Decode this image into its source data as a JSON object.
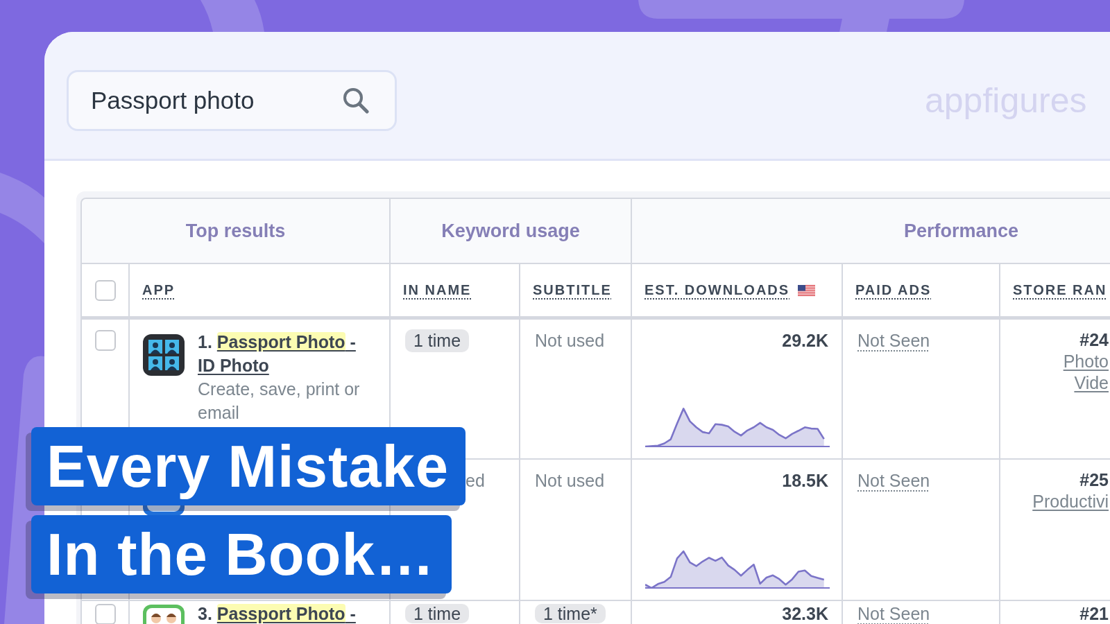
{
  "search": {
    "value": "Passport photo"
  },
  "logo": {
    "text": "appfigures"
  },
  "table": {
    "groups": [
      "Top results",
      "Keyword usage",
      "Performance"
    ],
    "select_all": {
      "checked": false
    },
    "columns": [
      {
        "label": "APP"
      },
      {
        "label": "IN NAME"
      },
      {
        "label": "SUBTITLE"
      },
      {
        "label": "EST. DOWNLOADS",
        "flag": true
      },
      {
        "label": "PAID ADS"
      },
      {
        "label": "STORE RAN"
      }
    ],
    "rows": [
      {
        "kind": "full",
        "checked": false,
        "icon": {
          "kind": "portrait-grid"
        },
        "number": "1.",
        "name": [
          {
            "text": "Passport Photo",
            "highlighted": true
          },
          {
            "text": " - ID Photo",
            "highlighted": false
          }
        ],
        "description": "Create, save, print or email",
        "in_name": {
          "kind": "pill",
          "text": "1 time"
        },
        "subtitle": {
          "kind": "plain",
          "text": "Not used"
        },
        "downloads": "29.2K",
        "paid_ads": "Not Seen",
        "rank": "#24",
        "categories": [
          "Photo",
          "Vide"
        ]
      },
      {
        "kind": "partial",
        "icon": {
          "kind": "framed"
        },
        "in_name": {
          "kind": "tail",
          "text": "ed"
        },
        "subtitle": {
          "kind": "plain",
          "text": "Not used"
        },
        "downloads": "18.5K",
        "paid_ads": "Not Seen",
        "rank": "#25",
        "categories": [
          "Productivi"
        ]
      },
      {
        "kind": "full",
        "checked": false,
        "icon": {
          "kind": "portraits"
        },
        "number": "3.",
        "name": [
          {
            "text": "Passport Photo",
            "highlighted": true
          },
          {
            "text": " -",
            "highlighted": false
          }
        ],
        "in_name": {
          "kind": "pill",
          "text": "1 time"
        },
        "subtitle": {
          "kind": "pill",
          "text": "1 time*"
        },
        "downloads": "32.3K",
        "paid_ads": "Not Seen",
        "rank": "#21"
      }
    ]
  },
  "banner": {
    "lines": [
      "Every Mistake",
      "In the Book…"
    ]
  }
}
